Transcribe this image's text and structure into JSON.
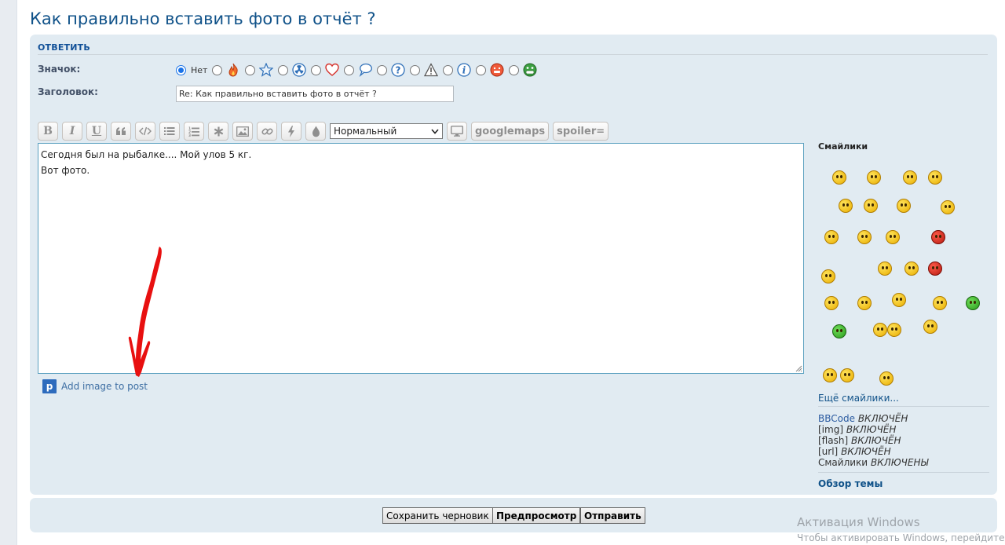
{
  "page": {
    "title": "Как правильно вставить фото в отчёт ?"
  },
  "panel": {
    "header": "ОТВЕТИТЬ",
    "icon_label": "Значок:",
    "icon_none_label": "Нет",
    "icons": [
      "fire-icon",
      "star-icon",
      "radiation-icon",
      "heart-icon",
      "speech-bubble-icon",
      "question-icon",
      "warning-icon",
      "info-icon",
      "sad-face-icon",
      "grin-face-icon"
    ],
    "subject_label": "Заголовок:",
    "subject_value": "Re: Как правильно вставить фото в отчёт ?"
  },
  "toolbar": {
    "buttons": [
      "bold",
      "italic",
      "underline",
      "quote",
      "code",
      "list",
      "numbered-list",
      "list-item",
      "image",
      "link",
      "flash",
      "color"
    ],
    "bold_label": "B",
    "italic_label": "I",
    "underline_label": "U",
    "font_size_selected": "Нормальный",
    "googlemaps_label": "googlemaps",
    "spoiler_label": "spoiler="
  },
  "editor": {
    "line1": "Сегодня был на рыбалке.... Мой улов 5 кг.",
    "line2": "Вот фото."
  },
  "add_image": {
    "label": "Add image to post"
  },
  "sidebar": {
    "smileys_title": "Смайлики",
    "more_smileys": "Ещё смайлики...",
    "bbcode": [
      {
        "key": "BBCode",
        "value": "ВКЛЮЧЁН"
      },
      {
        "key": "[img]",
        "value": "ВКЛЮЧЁН"
      },
      {
        "key": "[flash]",
        "value": "ВКЛЮЧЁН"
      },
      {
        "key": "[url]",
        "value": "ВКЛЮЧЁН"
      },
      {
        "key": "Смайлики",
        "value": "ВКЛЮЧЕНЫ"
      }
    ],
    "topic_overview": "Обзор темы"
  },
  "submit": {
    "save_draft": "Сохранить черновик",
    "preview": "Предпросмотр",
    "send": "Отправить"
  },
  "watermark": {
    "line1": "Активация Windows",
    "line2": "Чтобы активировать Windows, перейдите в ра"
  },
  "colors": {
    "title": "#105289",
    "panel": "#e1ebf2",
    "arrow": "#e81010"
  }
}
